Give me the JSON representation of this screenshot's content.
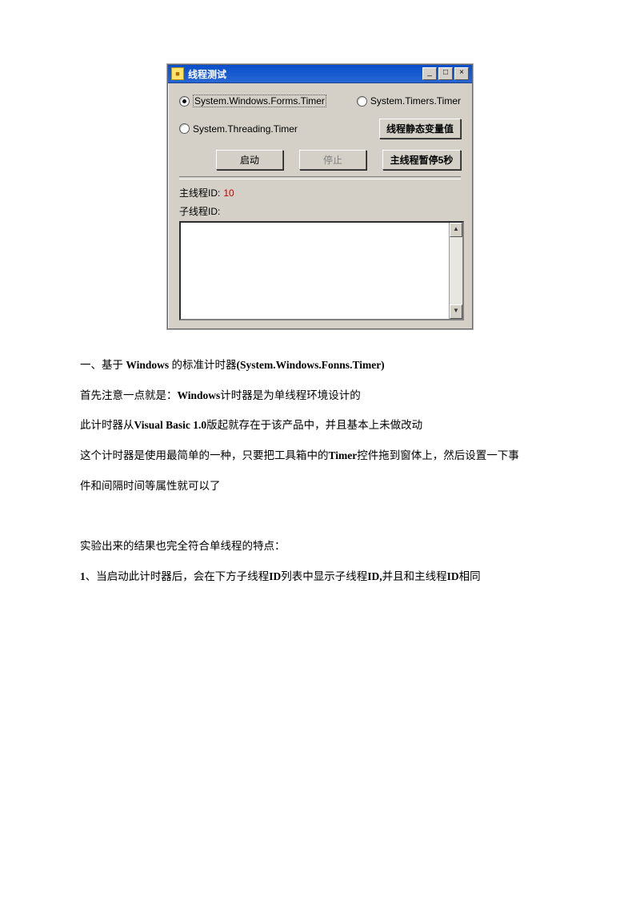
{
  "window": {
    "title": "线程测试",
    "radios": {
      "r1": "System.Windows.Forms.Timer",
      "r2": "System.Timers.Timer",
      "r3": "System.Threading.Timer"
    },
    "buttons": {
      "static_var": "线程静态变量值",
      "start": "启动",
      "stop": "停止",
      "pause5s": "主线程暂停5秒"
    },
    "main_thread_label": "主线程ID:",
    "main_thread_value": "10",
    "sub_thread_label": "子线程ID:"
  },
  "article": {
    "h1_a": "一、基于 ",
    "h1_b": "Windows",
    "h1_c": " 的标准计时器",
    "h1_d": "(System.Windows.Fonns.Timer)",
    "p1_a": "首先注意一点就是：",
    "p1_b": "Windows",
    "p1_c": "计时器是为单线程环境设计的",
    "p2_a": "此计时器从",
    "p2_b": "Visual Basic 1.0",
    "p2_c": "版起就存在于该产品中，并且基本上未做改动",
    "p3_a": "这个计时器是使用最简单的一种，只要把工具箱中的",
    "p3_b": "Timer",
    "p3_c": "控件拖到窗体上，然后设置一下事",
    "p3_d": "件和间隔时间等属性就可以了",
    "p5": "实验出来的结果也完全符合单线程的特点：",
    "p6_a": "1",
    "p6_b": "、当启动此计时器后，会在下方子线程",
    "p6_c": "ID",
    "p6_d": "列表中显示子线程",
    "p6_e": "ID,",
    "p6_f": "并且和主线程",
    "p6_g": "ID",
    "p6_h": "相同"
  }
}
